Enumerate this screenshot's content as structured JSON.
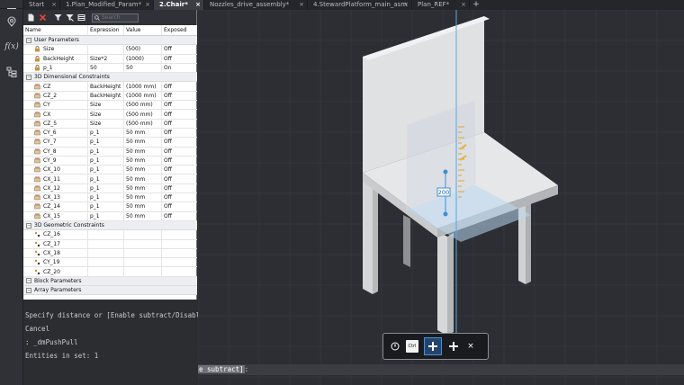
{
  "tabs": [
    {
      "label": "Start"
    },
    {
      "label": "1.Plan_Modified_Param*"
    },
    {
      "label": "2.Chair*",
      "active": true
    },
    {
      "label": "Nozzles_drive_assembly*"
    },
    {
      "label": "4.StewardPlatform_main_asm"
    },
    {
      "label": "Plan_REF*"
    }
  ],
  "rail": {
    "icons": [
      "menu-icon",
      "pin-icon",
      "function-icon",
      "tree-icon"
    ],
    "function_label": "f(x)"
  },
  "toolbar": {
    "search_placeholder": "Search"
  },
  "columns": [
    "Name",
    "Expression",
    "Value",
    "Exposed"
  ],
  "groups": {
    "user": "User Parameters",
    "dim": "3D Dimensional Constraints",
    "geo": "3D Geometric Constraints",
    "block": "Block Parameters",
    "array": "Array Parameters"
  },
  "user_params": [
    {
      "name": "Size",
      "expr": "",
      "value": "(500)",
      "exposed": "Off"
    },
    {
      "name": "BackHeight",
      "expr": "Size*2",
      "value": "(1000)",
      "exposed": "Off"
    },
    {
      "name": "p_1",
      "expr": "50",
      "value": "50",
      "exposed": "On"
    }
  ],
  "dim_constraints": [
    {
      "name": "CZ",
      "expr": "BackHeight",
      "value": "(1000 mm)",
      "exposed": "Off"
    },
    {
      "name": "CZ_2",
      "expr": "BackHeight",
      "value": "(1000 mm)",
      "exposed": "Off"
    },
    {
      "name": "CY",
      "expr": "Size",
      "value": "(500 mm)",
      "exposed": "Off"
    },
    {
      "name": "CX",
      "expr": "Size",
      "value": "(500 mm)",
      "exposed": "Off"
    },
    {
      "name": "CZ_5",
      "expr": "Size",
      "value": "(500 mm)",
      "exposed": "Off"
    },
    {
      "name": "CY_6",
      "expr": "p_1",
      "value": "50 mm",
      "exposed": "Off"
    },
    {
      "name": "CY_7",
      "expr": "p_1",
      "value": "50 mm",
      "exposed": "Off"
    },
    {
      "name": "CY_8",
      "expr": "p_1",
      "value": "50 mm",
      "exposed": "Off"
    },
    {
      "name": "CY_9",
      "expr": "p_1",
      "value": "50 mm",
      "exposed": "Off"
    },
    {
      "name": "CX_10",
      "expr": "p_1",
      "value": "50 mm",
      "exposed": "Off"
    },
    {
      "name": "CX_11",
      "expr": "p_1",
      "value": "50 mm",
      "exposed": "Off"
    },
    {
      "name": "CX_12",
      "expr": "p_1",
      "value": "50 mm",
      "exposed": "Off"
    },
    {
      "name": "CX_13",
      "expr": "p_1",
      "value": "50 mm",
      "exposed": "Off"
    },
    {
      "name": "CZ_14",
      "expr": "p_1",
      "value": "50 mm",
      "exposed": "Off"
    },
    {
      "name": "CX_15",
      "expr": "p_1",
      "value": "50 mm",
      "exposed": "Off"
    }
  ],
  "geo_constraints": [
    {
      "name": "CZ_16"
    },
    {
      "name": "CZ_17"
    },
    {
      "name": "CX_18"
    },
    {
      "name": "CY_19"
    },
    {
      "name": "CZ_20"
    }
  ],
  "command_history": [
    "Specify distance or [Enable subtract/Disable subtract]:",
    "Cancel",
    ": _dmPushPull",
    "Entities in set: 1"
  ],
  "command_input": {
    "highlight": "e subtract]",
    "rest": ":"
  },
  "viewport": {
    "dimension_value": "200"
  },
  "minibar": {
    "ctrl_label": "Ctrl",
    "close_label": "×"
  }
}
